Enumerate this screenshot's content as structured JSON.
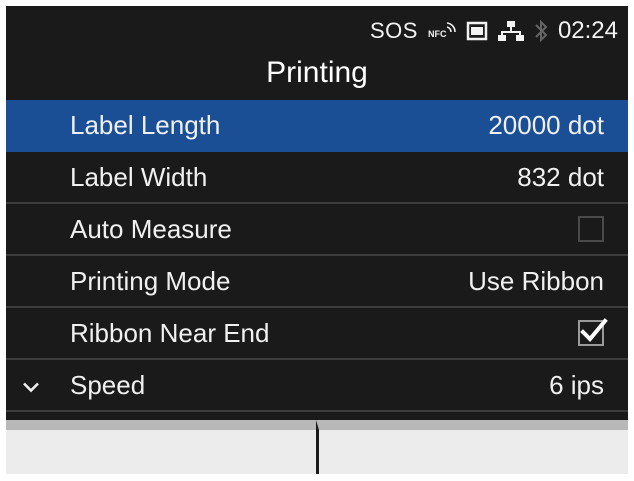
{
  "status": {
    "sos": "SOS",
    "nfc_icon": "nfc-icon",
    "sdcard_icon": "sd-card-icon",
    "network_icon": "network-icon",
    "bluetooth_icon": "bluetooth-icon",
    "time": "02:24"
  },
  "title": "Printing",
  "settings": [
    {
      "label": "Label Length",
      "value": "20000 dot",
      "selected": true
    },
    {
      "label": "Label Width",
      "value": "832 dot"
    },
    {
      "label": "Auto Measure",
      "checked": false
    },
    {
      "label": "Printing Mode",
      "value": "Use Ribbon"
    },
    {
      "label": "Ribbon Near End",
      "checked": true
    },
    {
      "label": "Speed",
      "value": "6 ips",
      "indicator": "chevron-down-icon"
    }
  ],
  "colors": {
    "background": "#1a1a1a",
    "selected_row": "#1b4f95",
    "text": "#f0f0f0",
    "function_keys": "#ececec"
  }
}
